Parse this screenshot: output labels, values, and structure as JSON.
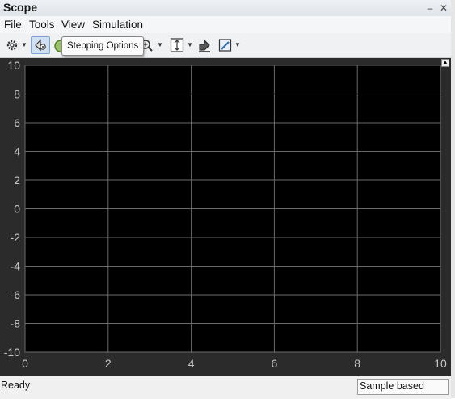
{
  "window": {
    "title": "Scope"
  },
  "menu": [
    "File",
    "Tools",
    "View",
    "Simulation"
  ],
  "toolbar": {
    "icons": [
      "gear-icon",
      "stepping-options-icon",
      "run-icon",
      "zoom-in-icon",
      "autoscale-icon",
      "restore-axes-icon",
      "highlight-icon"
    ],
    "tooltip": "Stepping Options"
  },
  "plot": {
    "background": "#000000",
    "frame_color": "#2b2b2b",
    "grid_color": "#6b6b6b",
    "tick_color": "#c8c8c8",
    "x_ticks": [
      "0",
      "2",
      "4",
      "6",
      "8",
      "10"
    ],
    "y_ticks": [
      "10",
      "8",
      "6",
      "4",
      "2",
      "0",
      "-2",
      "-4",
      "-6",
      "-8",
      "-10"
    ]
  },
  "chart_data": {
    "type": "line",
    "series": [],
    "xlim": [
      0,
      10
    ],
    "ylim": [
      -10,
      10
    ],
    "grid": true
  },
  "status": {
    "text": "Ready",
    "mode": "Sample based"
  }
}
